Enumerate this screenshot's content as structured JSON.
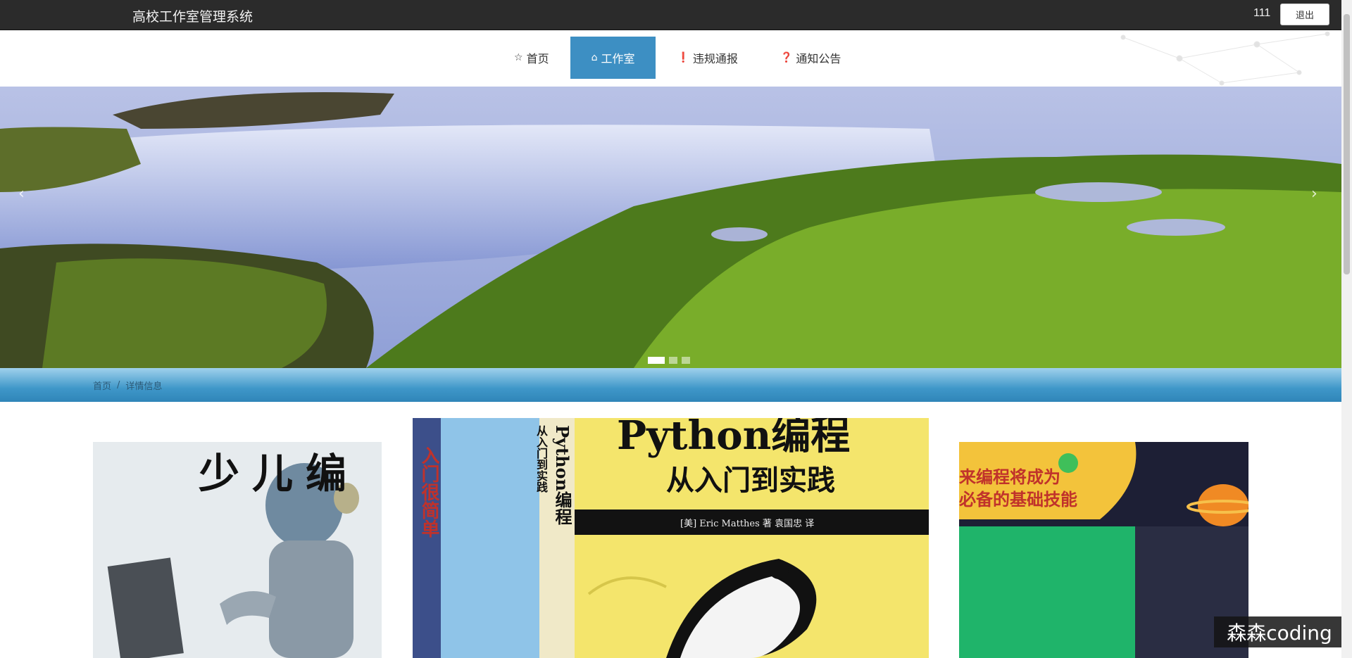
{
  "header": {
    "title": "高校工作室管理系统",
    "username": "111",
    "logout_label": "退出"
  },
  "nav": {
    "items": [
      {
        "label": "首页",
        "icon": "home-icon"
      },
      {
        "label": "工作室",
        "icon": "house-icon"
      },
      {
        "label": "违规通报",
        "icon": "alert-icon"
      },
      {
        "label": "通知公告",
        "icon": "question-icon"
      }
    ],
    "active_index": 1
  },
  "carousel": {
    "prev": "‹",
    "next": "›",
    "slide_count": 3,
    "active_slide": 0
  },
  "breadcrumb": {
    "home": "首页",
    "separator": "/",
    "current": "详情信息"
  },
  "cards": [
    {
      "text_top": "少儿编"
    },
    {
      "title": "Python编程",
      "subtitle": "从入门到实践",
      "author": "[美] Eric Matthes 著  袁国忠 译",
      "spine": "Python编程",
      "spine_sub": "从入门到实践",
      "side": "入门很简单"
    },
    {
      "line1": "来编程将成为",
      "line2": "必备的基础技能"
    }
  ],
  "watermark": "森森coding",
  "colors": {
    "topbar": "#2b2b2b",
    "nav_active": "#3d8fc3",
    "crumb_bar": "#3f97c9"
  }
}
